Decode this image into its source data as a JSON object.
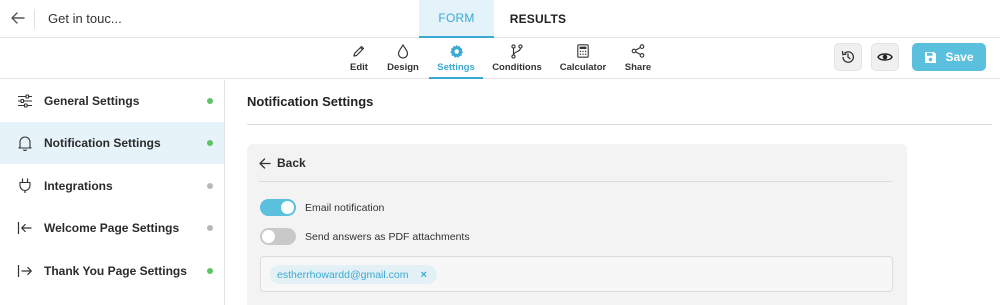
{
  "topbar": {
    "form_title": "Get in touc...",
    "tabs": [
      {
        "label": "FORM"
      },
      {
        "label": "RESULTS"
      }
    ]
  },
  "toolbar": {
    "items": [
      {
        "label": "Edit",
        "icon": "pencil-icon"
      },
      {
        "label": "Design",
        "icon": "droplet-icon"
      },
      {
        "label": "Settings",
        "icon": "gear-icon"
      },
      {
        "label": "Conditions",
        "icon": "branch-icon"
      },
      {
        "label": "Calculator",
        "icon": "calculator-icon"
      },
      {
        "label": "Share",
        "icon": "share-icon"
      }
    ],
    "save_label": "Save"
  },
  "sidebar": {
    "items": [
      {
        "label": "General Settings",
        "icon": "sliders-icon",
        "status": "green"
      },
      {
        "label": "Notification Settings",
        "icon": "bell-icon",
        "status": "green"
      },
      {
        "label": "Integrations",
        "icon": "plug-icon",
        "status": "gray"
      },
      {
        "label": "Welcome Page Settings",
        "icon": "enter-icon",
        "status": "gray"
      },
      {
        "label": "Thank You Page Settings",
        "icon": "exit-icon",
        "status": "green"
      }
    ]
  },
  "main": {
    "title": "Notification Settings",
    "back_label": "Back",
    "email_notification": {
      "label": "Email notification",
      "enabled": true
    },
    "pdf_attachments": {
      "label": "Send answers as PDF attachments",
      "enabled": false
    },
    "recipients": [
      "estherrhowardd@gmail.com"
    ]
  },
  "colors": {
    "accent": "#5bc0de",
    "accent_text": "#3aa9d2",
    "status_green": "#5cc465",
    "status_gray": "#b8b8b8"
  }
}
